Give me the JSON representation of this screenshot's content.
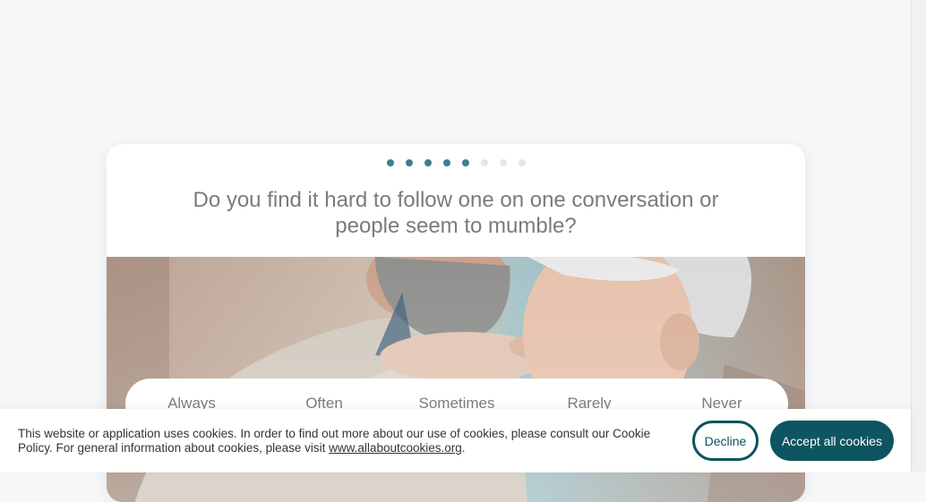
{
  "quiz": {
    "progress": {
      "total_steps": 8,
      "current_step": 5
    },
    "question": "Do you find it hard to follow one on one conversation or people seem to mumble?",
    "answers": [
      "Always",
      "Often",
      "Sometimes",
      "Rarely",
      "Never"
    ],
    "accent_color": "#3a8090"
  },
  "cookie_banner": {
    "text_before_link": "This website or application uses cookies. In order to find out more about our use of cookies, please consult our Cookie Policy. For general information about cookies, please visit ",
    "link_text": "www.allaboutcookies.org",
    "text_after_link": ".",
    "decline_label": "Decline",
    "accept_label": "Accept all cookies",
    "button_color": "#0d5560"
  }
}
